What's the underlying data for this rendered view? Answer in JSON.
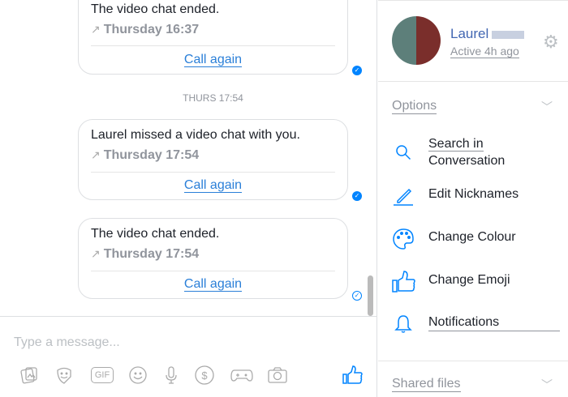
{
  "messages": [
    {
      "text": "The video chat ended.",
      "time": "Thursday 16:37",
      "action": "Call again",
      "status": "seen"
    },
    {
      "text": "Laurel missed a video chat with you.",
      "time": "Thursday 17:54",
      "action": "Call again",
      "status": "seen"
    },
    {
      "text": "The video chat ended.",
      "time": "Thursday 17:54",
      "action": "Call again",
      "status": "sent"
    }
  ],
  "timestamp_divider": "THURS 17:54",
  "composer": {
    "placeholder": "Type a message...",
    "icons": [
      "photo-icon",
      "sticker-icon",
      "gif-icon",
      "emoji-icon",
      "microphone-icon",
      "payment-icon",
      "game-icon",
      "camera-icon",
      "like-icon"
    ],
    "gif_label": "GIF",
    "dollar": "$"
  },
  "profile": {
    "name": "Laurel",
    "status": "Active 4h ago"
  },
  "options": {
    "title": "Options",
    "items": [
      {
        "label_line1": "Search in",
        "label_line2": "Conversation",
        "icon": "search-icon"
      },
      {
        "label": "Edit Nicknames",
        "icon": "pencil-icon"
      },
      {
        "label": "Change Colour",
        "icon": "palette-icon"
      },
      {
        "label": "Change Emoji",
        "icon": "thumbs-up-icon"
      },
      {
        "label": "Notifications",
        "icon": "bell-icon"
      }
    ]
  },
  "shared_files": {
    "title": "Shared files"
  },
  "colors": {
    "accent": "#0084ff",
    "link": "#2a7fd8",
    "name": "#4267b2"
  }
}
